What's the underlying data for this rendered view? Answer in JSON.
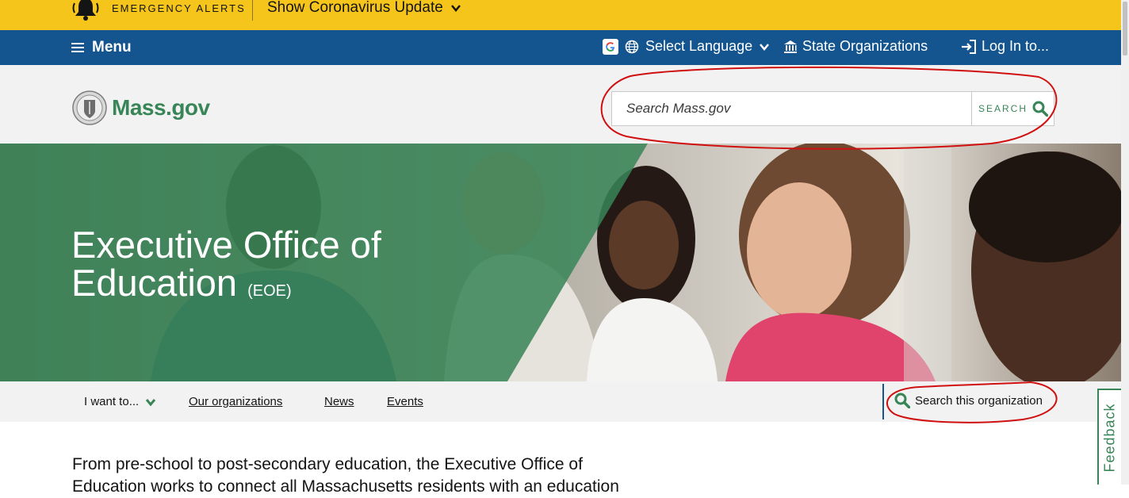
{
  "alert_bar": {
    "label": "EMERGENCY ALERTS",
    "toggle": "Show Coronavirus Update",
    "icon": "bell-icon",
    "background": "#f6c51b"
  },
  "utility_nav": {
    "menu": "Menu",
    "language": "Select Language",
    "state_orgs": "State Organizations",
    "login": "Log In to...",
    "background": "#14558f"
  },
  "header": {
    "brand": "Mass.gov",
    "search_placeholder": "Search Mass.gov",
    "search_button": "SEARCH"
  },
  "hero": {
    "title_line1": "Executive Office of",
    "title_line2": "Education",
    "acronym": "(EOE)",
    "overlay_color": "#388557"
  },
  "org_nav": {
    "i_want_to": "I want to...",
    "links": [
      "Our organizations",
      "News",
      "Events"
    ],
    "search": "Search this organization"
  },
  "intro": {
    "line1": "From pre-school to post-secondary education, the Executive Office of",
    "line2": "Education works to connect all Massachusetts residents with an education"
  },
  "feedback": "Feedback",
  "colors": {
    "accent_green": "#388557",
    "annotation_red": "#d01010"
  }
}
